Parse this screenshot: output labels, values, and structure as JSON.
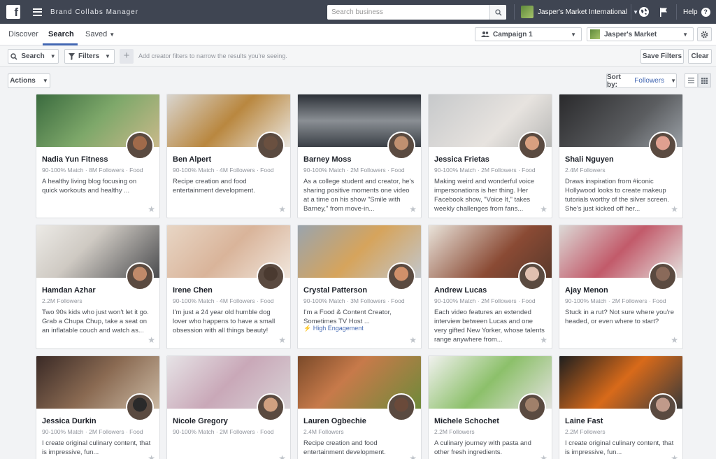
{
  "topbar": {
    "logo": "f",
    "app_title": "Brand Collabs Manager",
    "search_placeholder": "Search business",
    "account_name": "Jasper's Market International",
    "help_label": "Help"
  },
  "nav": {
    "tabs": [
      {
        "label": "Discover"
      },
      {
        "label": "Search"
      },
      {
        "label": "Saved"
      }
    ],
    "campaign_select": "Campaign 1",
    "page_select": "Jasper's Market"
  },
  "filters": {
    "search_label": "Search",
    "filters_label": "Filters",
    "hint": "Add creator filters to narrow the results you're seeing.",
    "save_label": "Save Filters",
    "clear_label": "Clear"
  },
  "toolbar": {
    "actions_label": "Actions",
    "sort_prefix": "Sort by:",
    "sort_value": "Followers"
  },
  "colors": {
    "topbar": "#3f4552",
    "accent": "#4267b2"
  },
  "cards": [
    {
      "name": "Nadia Yun Fitness",
      "meta": "90-100% Match · 8M Followers · Food",
      "desc": "A healthy living blog focusing on quick workouts and healthy ...",
      "highlight": ""
    },
    {
      "name": "Ben Alpert",
      "meta": "90-100% Match · 4M Followers · Food",
      "desc": "Recipe creation and food entertainment development.",
      "highlight": ""
    },
    {
      "name": "Barney Moss",
      "meta": "90-100% Match · 2M Followers · Food",
      "desc": "As a college student and creator, he's sharing positive moments one video at a time on his show \"Smile with Barney,\" from move-in...",
      "highlight": ""
    },
    {
      "name": "Jessica Frietas",
      "meta": "90-100% Match · 2M Followers · Food",
      "desc": "Making weird and wonderful voice impersonations is her thing. Her Facebook show, \"Voice It,\" takes weekly challenges from fans...",
      "highlight": ""
    },
    {
      "name": "Shali Nguyen",
      "meta": "2.4M Followers",
      "desc": "Draws inspiration from #iconic Hollywood looks to create makeup tutorials worthy of the silver screen. She's just kicked off her...",
      "highlight": ""
    },
    {
      "name": "Hamdan Azhar",
      "meta": "2.2M Followers",
      "desc": "Two 90s kids who just won't let it go. Grab a Chupa Chup, take a seat on an inflatable couch and watch as...",
      "highlight": ""
    },
    {
      "name": "Irene Chen",
      "meta": "90-100% Match · 4M Followers · Food",
      "desc": "I'm just a 24 year old humble dog lover who happens to have a small obsession with all things beauty!",
      "highlight": ""
    },
    {
      "name": "Crystal Patterson",
      "meta": "90-100% Match · 3M Followers · Food",
      "desc": "I'm a Food & Content Creator, Sometimes TV Host ...",
      "highlight": "High Engagement"
    },
    {
      "name": "Andrew Lucas",
      "meta": "90-100% Match · 2M Followers · Food",
      "desc": "Each video features an extended interview between Lucas and one very gifted New Yorker, whose talents range anywhere from...",
      "highlight": ""
    },
    {
      "name": "Ajay Menon",
      "meta": "90-100% Match · 2M Followers · Food",
      "desc": "Stuck in a rut? Not sure where you're headed, or even where to start?",
      "highlight": ""
    },
    {
      "name": "Jessica Durkin",
      "meta": "90-100% Match · 2M Followers · Food",
      "desc": "I create original culinary content, that is impressive, fun...",
      "highlight": ""
    },
    {
      "name": "Nicole Gregory",
      "meta": "90-100% Match · 2M Followers · Food",
      "desc": "",
      "highlight": ""
    },
    {
      "name": "Lauren Ogbechie",
      "meta": "2.4M Followers",
      "desc": "Recipe creation and food entertainment development.",
      "highlight": ""
    },
    {
      "name": "Michele Schochet",
      "meta": "2.2M Followers",
      "desc": "A culinary journey with pasta and other fresh ingredients.",
      "highlight": ""
    },
    {
      "name": "Laine Fast",
      "meta": "2.2M Followers",
      "desc": "I create original culinary content, that is impressive, fun...",
      "highlight": ""
    }
  ]
}
